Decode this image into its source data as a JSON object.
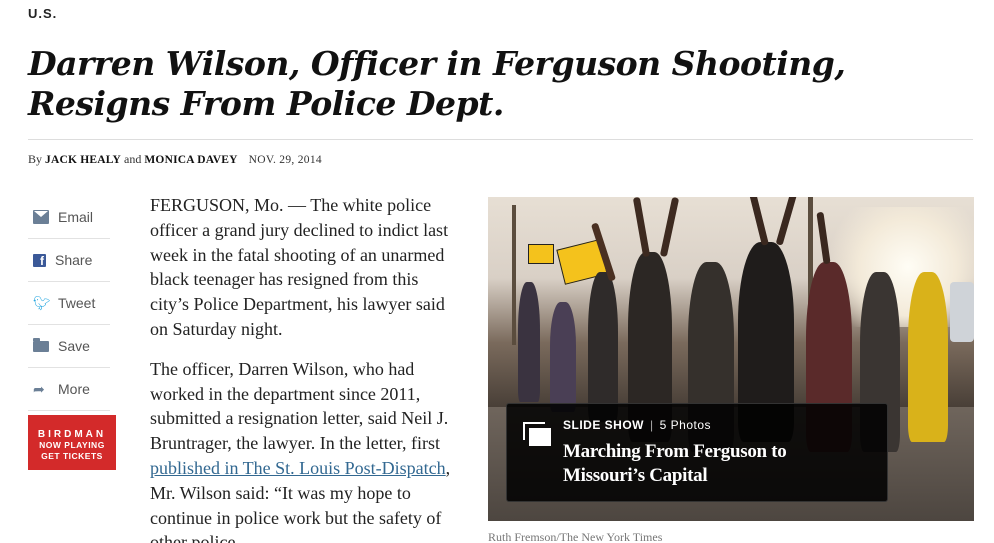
{
  "section": "U.S.",
  "headline": "Darren Wilson, Officer in Ferguson Shooting, Resigns From Police Dept.",
  "byline": {
    "prefix": "By",
    "author1": "JACK HEALY",
    "and": "and",
    "author2": "MONICA DAVEY",
    "date": "NOV. 29, 2014"
  },
  "share": {
    "items": [
      {
        "label": "Email",
        "icon": "email-icon"
      },
      {
        "label": "Share",
        "icon": "facebook-icon"
      },
      {
        "label": "Tweet",
        "icon": "twitter-icon"
      },
      {
        "label": "Save",
        "icon": "save-icon"
      },
      {
        "label": "More",
        "icon": "more-arrow-icon"
      }
    ]
  },
  "ad": {
    "title": "BIRDMAN",
    "line1": "NOW PLAYING",
    "line2": "GET TICKETS",
    "color": "#d32a2a"
  },
  "article": {
    "p1": "FERGUSON, Mo. — The white police officer a grand jury declined to indict last week in the fatal shooting of an unarmed black teenager has resigned from this city’s Police Department, his lawyer said on Saturday night.",
    "p2_before": "The officer, Darren Wilson, who had worked in the department since 2011, submitted a resignation letter, said Neil J. Bruntrager, the lawyer. In the letter, first ",
    "p2_link": "published in The St. Louis Post-Dispatch",
    "p2_after": ", Mr. Wilson said: “It was my hope to continue in police work but the safety of other police"
  },
  "slideshow": {
    "label": "SLIDE SHOW",
    "separator": "|",
    "count": "5 Photos",
    "title": "Marching From Ferguson to Missouri’s Capital"
  },
  "photo_credit": "Ruth Fremson/The New York Times",
  "colors": {
    "link": "#326891",
    "icon_gray": "#6b7f96",
    "facebook": "#3b5998",
    "twitter": "#2ba9e1"
  }
}
